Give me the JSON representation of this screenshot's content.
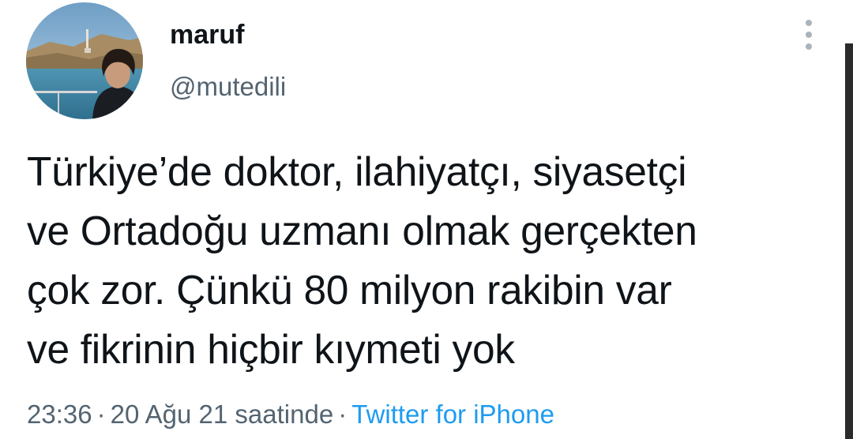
{
  "tweet": {
    "author": {
      "display_name": "maruf",
      "handle": "@mutedili"
    },
    "text": "Türkiye’de doktor, ilahiyatçı, siyasetçi\nve Ortadoğu uzmanı olmak gerçekten\nçok zor. Çünkü 80 milyon rakibin var\nve fikrinin hiçbir kıymeti yok",
    "timestamp": "23:36",
    "date": "20 Ağu 21 saatinde",
    "separator": "·",
    "source": "Twitter for iPhone"
  },
  "icons": {
    "more": "more-vertical-icon",
    "avatar": "profile-photo"
  },
  "colors": {
    "text_primary": "#0f1419",
    "text_secondary": "#536471",
    "link": "#1d9bf0",
    "background": "#ffffff"
  }
}
